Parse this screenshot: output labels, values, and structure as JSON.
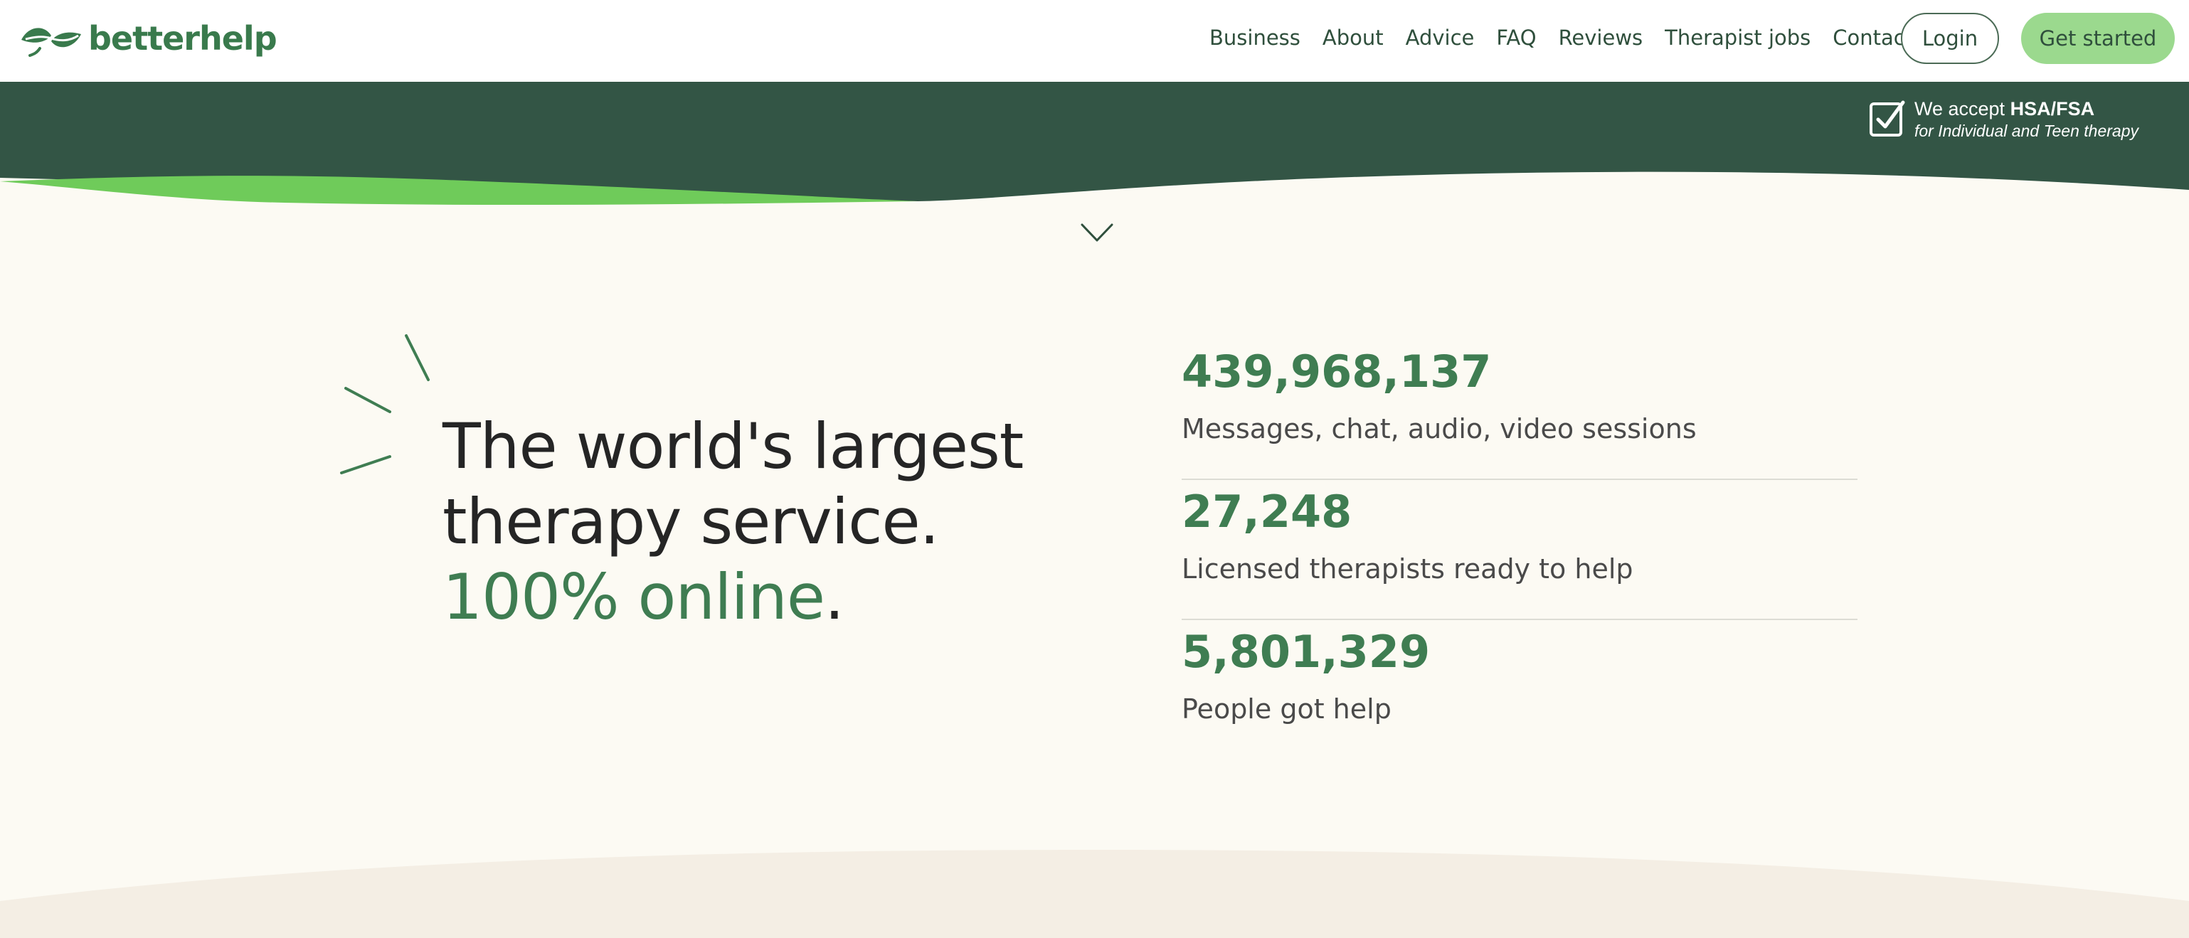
{
  "brand": {
    "name": "betterhelp",
    "primary_color": "#397a4c",
    "banner_color": "#335545",
    "wave_accent_color": "#6fcb5a",
    "button_color": "#9bd98e",
    "background_color": "#fcfaf3"
  },
  "nav": {
    "links": [
      "Business",
      "About",
      "Advice",
      "FAQ",
      "Reviews",
      "Therapist jobs",
      "Contact"
    ],
    "login_label": "Login",
    "cta_label": "Get started"
  },
  "banner": {
    "hsa_prefix": "We accept ",
    "hsa_bold": "HSA/FSA",
    "hsa_sub": "for Individual and Teen therapy",
    "icon": "checkbox-icon"
  },
  "scroll_icon": "chevron-down-icon",
  "hero": {
    "line1": "The world's largest",
    "line2": "therapy service.",
    "line3_accent": "100% online",
    "line3_end": "."
  },
  "stats": [
    {
      "number": "439,968,137",
      "label": "Messages, chat, audio, video sessions"
    },
    {
      "number": "27,248",
      "label": "Licensed therapists ready to help"
    },
    {
      "number": "5,801,329",
      "label": "People got help"
    }
  ]
}
